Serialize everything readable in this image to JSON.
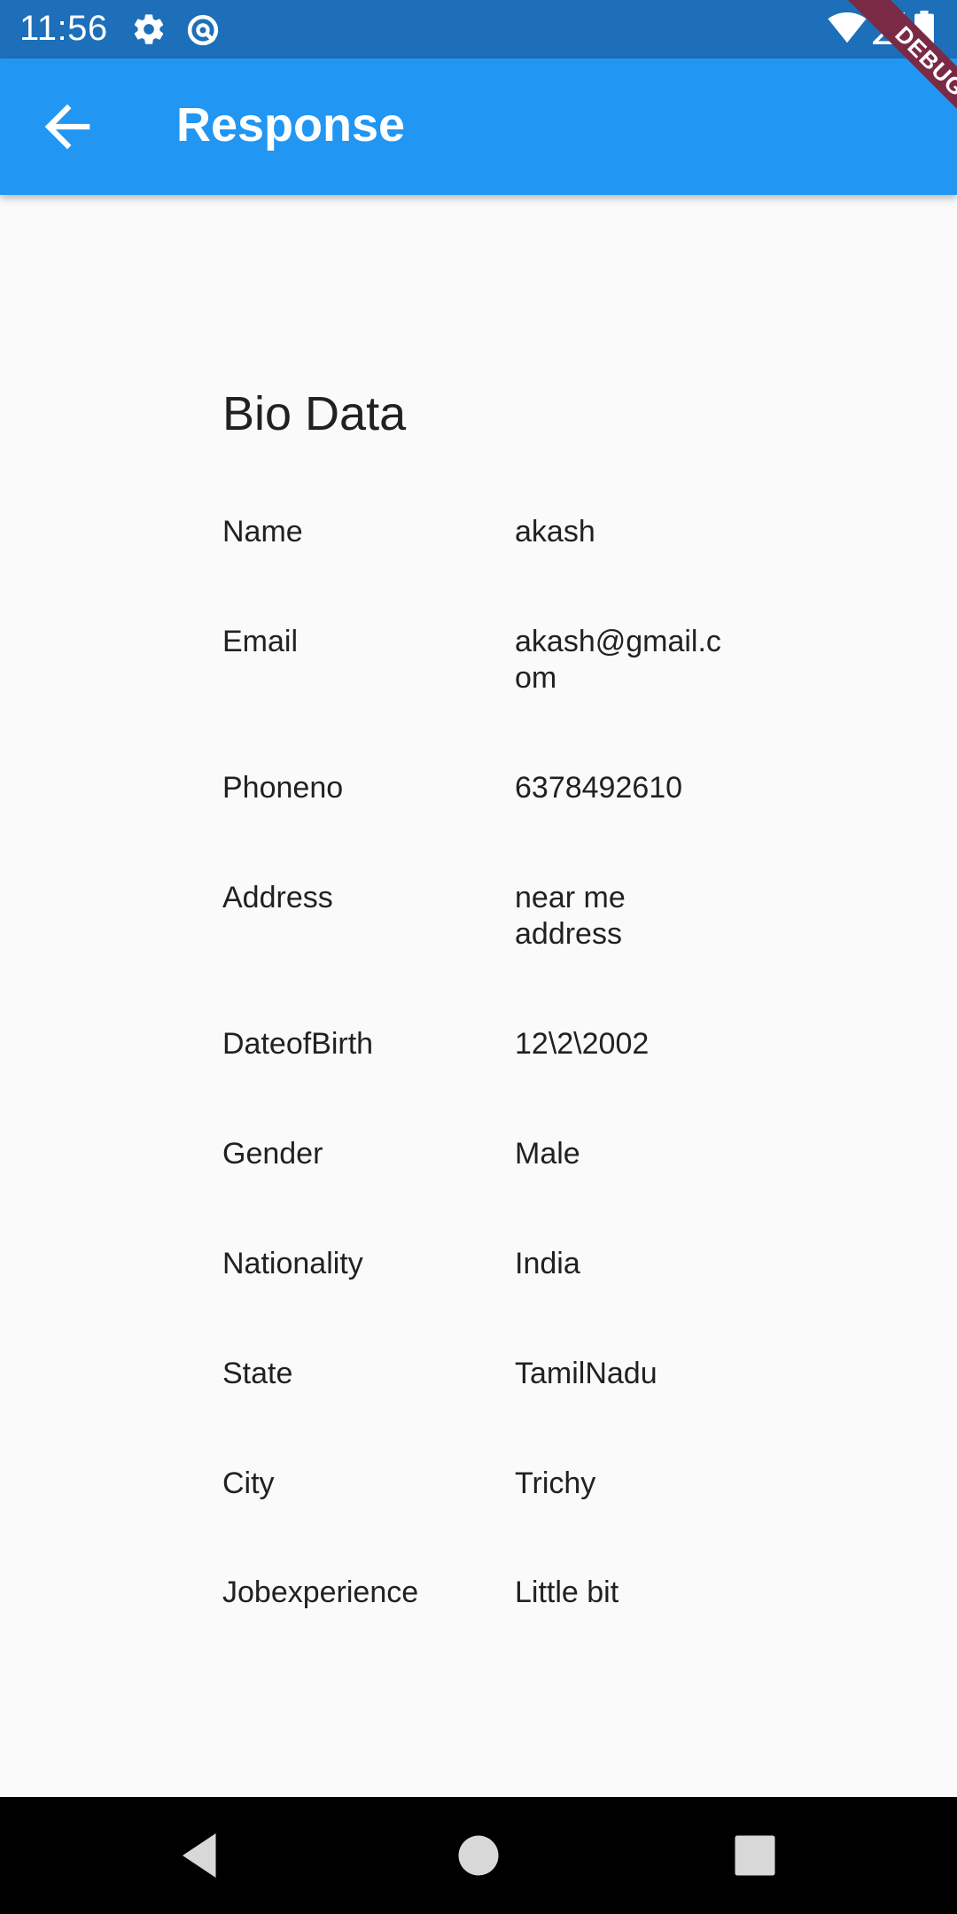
{
  "status_bar": {
    "time": "11:56",
    "icons": [
      "settings-icon",
      "data-saver-icon",
      "wifi-icon",
      "signal-icon",
      "battery-icon"
    ]
  },
  "app_bar": {
    "title": "Response",
    "back_icon": "arrow-back-icon",
    "color": "#2196f3"
  },
  "debug_banner": "DEBUG",
  "bio": {
    "title": "Bio Data",
    "rows": [
      {
        "label": "Name",
        "value": "akash"
      },
      {
        "label": "Email",
        "value": "akash@gmail.com"
      },
      {
        "label": "Phoneno",
        "value": "6378492610"
      },
      {
        "label": "Address",
        "value": "near me address"
      },
      {
        "label": "DateofBirth",
        "value": "12\\2\\2002"
      },
      {
        "label": "Gender",
        "value": "Male"
      },
      {
        "label": "Nationality",
        "value": "India"
      },
      {
        "label": "State",
        "value": "TamilNadu"
      },
      {
        "label": "City",
        "value": "Trichy"
      },
      {
        "label": "Jobexperience",
        "value": "Little bit"
      }
    ]
  },
  "nav_bar": {
    "buttons": [
      "back-triangle-icon",
      "home-circle-icon",
      "recents-square-icon"
    ]
  }
}
